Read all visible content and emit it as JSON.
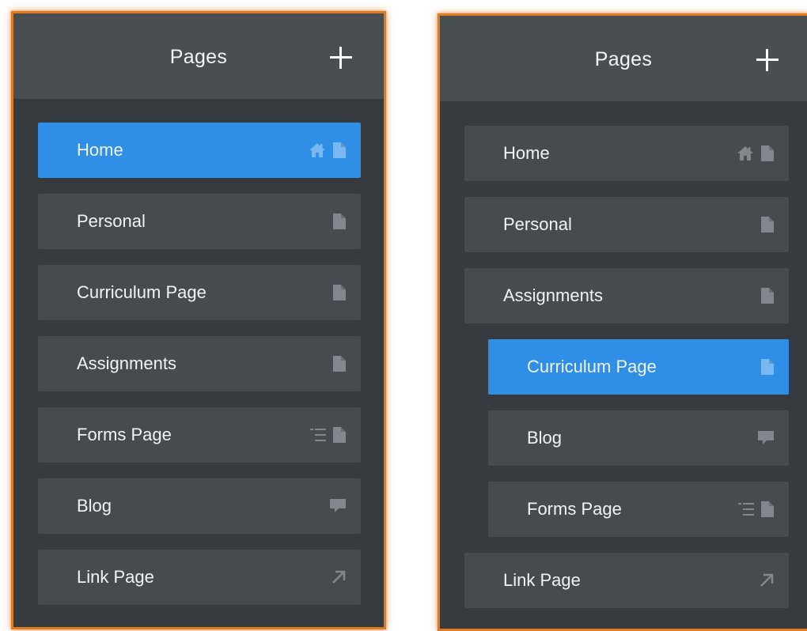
{
  "colors": {
    "panel_bg": "#363b3f",
    "header_bg": "#494e52",
    "item_bg": "#464b4f",
    "active_bg": "#2f8ee6",
    "border": "#e07b1f",
    "icon": "#81878c",
    "icon_active": "#7ab8f2"
  },
  "left_panel": {
    "title": "Pages",
    "add_icon": "plus-icon",
    "items": [
      {
        "label": "Home",
        "active": true,
        "icons": [
          "home-icon",
          "page-icon"
        ]
      },
      {
        "label": "Personal",
        "active": false,
        "icons": [
          "page-icon"
        ]
      },
      {
        "label": "Curriculum Page",
        "active": false,
        "icons": [
          "page-icon"
        ]
      },
      {
        "label": "Assignments",
        "active": false,
        "icons": [
          "page-icon"
        ]
      },
      {
        "label": "Forms Page",
        "active": false,
        "icons": [
          "form-list-icon",
          "page-icon"
        ]
      },
      {
        "label": "Blog",
        "active": false,
        "icons": [
          "comment-icon"
        ]
      },
      {
        "label": "Link Page",
        "active": false,
        "icons": [
          "external-link-icon"
        ]
      }
    ]
  },
  "right_panel": {
    "title": "Pages",
    "add_icon": "plus-icon",
    "items": [
      {
        "label": "Home",
        "active": false,
        "level": 0,
        "icons": [
          "home-icon",
          "page-icon"
        ]
      },
      {
        "label": "Personal",
        "active": false,
        "level": 0,
        "icons": [
          "page-icon"
        ]
      },
      {
        "label": "Assignments",
        "active": false,
        "level": 0,
        "icons": [
          "page-icon"
        ]
      },
      {
        "label": "Curriculum Page",
        "active": true,
        "level": 1,
        "icons": [
          "page-icon"
        ]
      },
      {
        "label": "Blog",
        "active": false,
        "level": 1,
        "icons": [
          "comment-icon"
        ]
      },
      {
        "label": "Forms Page",
        "active": false,
        "level": 1,
        "icons": [
          "form-list-icon",
          "page-icon"
        ]
      },
      {
        "label": "Link Page",
        "active": false,
        "level": 0,
        "icons": [
          "external-link-icon"
        ]
      }
    ]
  }
}
